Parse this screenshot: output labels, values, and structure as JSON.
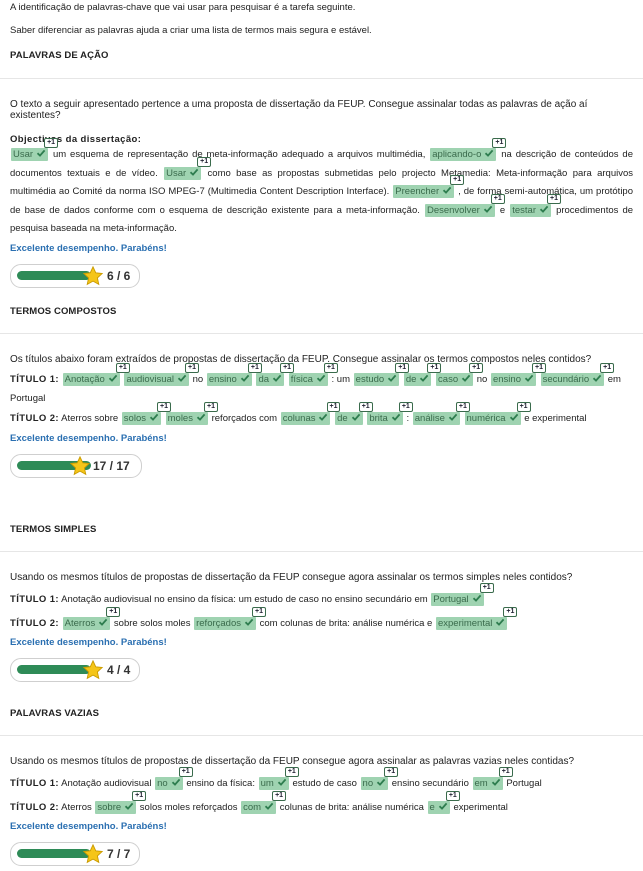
{
  "intro": {
    "line1": "A identificação de palavras-chave que vai usar para pesquisar é a tarefa seguinte.",
    "line2": "Saber diferenciar as palavras ajuda a criar uma lista de termos mais segura e estável."
  },
  "badge": "+1",
  "sections": [
    {
      "title": "PALAVRAS DE AÇÃO",
      "question": "O texto a seguir apresentado pertence a uma proposta de dissertação da FEUP. Consegue assinalar todas as palavras de ação aí existentes?",
      "objectives_label": "Objectivos da dissertação:",
      "feedback": "Excelente desempenho. Parabéns!",
      "score": "6 / 6",
      "score_fraction": 1.0
    },
    {
      "title": "TERMOS COMPOSTOS",
      "question": "Os títulos abaixo foram extraídos de propostas de dissertação da FEUP. Consegue assinalar os termos compostos neles contidos?",
      "feedback": "Excelente desempenho. Parabéns!",
      "score": "17 / 17",
      "score_fraction": 1.0
    },
    {
      "title": "TERMOS SIMPLES",
      "question": "Usando os mesmos títulos de propostas de dissertação da FEUP consegue agora assinalar os termos simples neles contidos?",
      "feedback": "Excelente desempenho. Parabéns!",
      "score": "4 / 4",
      "score_fraction": 1.0
    },
    {
      "title": "PALAVRAS VAZIAS",
      "question": "Usando os mesmos títulos de propostas de dissertação da FEUP consegue agora assinalar as palavras vazias neles contidas?",
      "feedback": "Excelente desempenho. Parabéns!",
      "score": "7 / 7",
      "score_fraction": 1.0
    }
  ],
  "s1_text": [
    {
      "k": "Usar"
    },
    {
      "t": "um esquema de representação de meta-informação adequado a arquivos multimédia,"
    },
    {
      "k": "aplicando-o"
    },
    {
      "t": "na descrição de conteúdos de documentos textuais e de vídeo."
    },
    {
      "k": "Usar"
    },
    {
      "t": "como base as propostas submetidas pelo projecto Metamedia: Meta-informação para arquivos multimédia ao Comité da norma ISO MPEG-7 (Multimedia Content Description Interface)."
    },
    {
      "k": "Preencher"
    },
    {
      "t": ", de forma semi-automática, um protótipo de base de dados conforme com o esquema de descrição existente para a meta-informação."
    },
    {
      "k": "Desenvolver"
    },
    {
      "t": "e"
    },
    {
      "k": "testar"
    },
    {
      "t": "procedimentos de pesquisa baseada na meta-informação."
    }
  ],
  "titulo1_label": "TÍTULO 1:",
  "titulo2_label": "TÍTULO 2:",
  "s2_t1": [
    {
      "k": "Anotação"
    },
    {
      "k": "audiovisual"
    },
    {
      "t": "no"
    },
    {
      "k": "ensino"
    },
    {
      "k": "da"
    },
    {
      "k": "física"
    },
    {
      "t": ": um"
    },
    {
      "k": "estudo"
    },
    {
      "k": "de"
    },
    {
      "k": "caso"
    },
    {
      "t": "no"
    },
    {
      "k": "ensino"
    },
    {
      "k": "secundário"
    },
    {
      "t": "em Portugal"
    }
  ],
  "s2_t2": [
    {
      "t": "Aterros sobre"
    },
    {
      "k": "solos"
    },
    {
      "k": "moles"
    },
    {
      "t": "reforçados com"
    },
    {
      "k": "colunas"
    },
    {
      "k": "de"
    },
    {
      "k": "brita"
    },
    {
      "t": ":"
    },
    {
      "k": "análise"
    },
    {
      "k": "numérica"
    },
    {
      "t": "e experimental"
    }
  ],
  "s3_t1": [
    {
      "t": "Anotação audiovisual no ensino da física: um estudo de caso no ensino secundário em"
    },
    {
      "k": "Portugal"
    }
  ],
  "s3_t2": [
    {
      "k": "Aterros"
    },
    {
      "t": "sobre solos moles"
    },
    {
      "k": "reforçados"
    },
    {
      "t": "com colunas de brita: análise numérica e"
    },
    {
      "k": "experimental"
    }
  ],
  "s4_t1": [
    {
      "t": "Anotação audiovisual"
    },
    {
      "k": "no"
    },
    {
      "t": "ensino da física:"
    },
    {
      "k": "um"
    },
    {
      "t": "estudo de caso"
    },
    {
      "k": "no"
    },
    {
      "t": "ensino secundário"
    },
    {
      "k": "em"
    },
    {
      "t": "Portugal"
    }
  ],
  "s4_t2": [
    {
      "t": "Aterros"
    },
    {
      "k": "sobre"
    },
    {
      "t": "solos moles reforçados"
    },
    {
      "k": "com"
    },
    {
      "t": "colunas de brita: análise numérica"
    },
    {
      "k": "e"
    },
    {
      "t": "experimental"
    }
  ],
  "colors": {
    "highlight": "#9fd3b1",
    "highlight_text": "#3a6b4c",
    "feedback": "#2a6fb1",
    "bar": "#2e8b57",
    "star": "#f5c518"
  }
}
